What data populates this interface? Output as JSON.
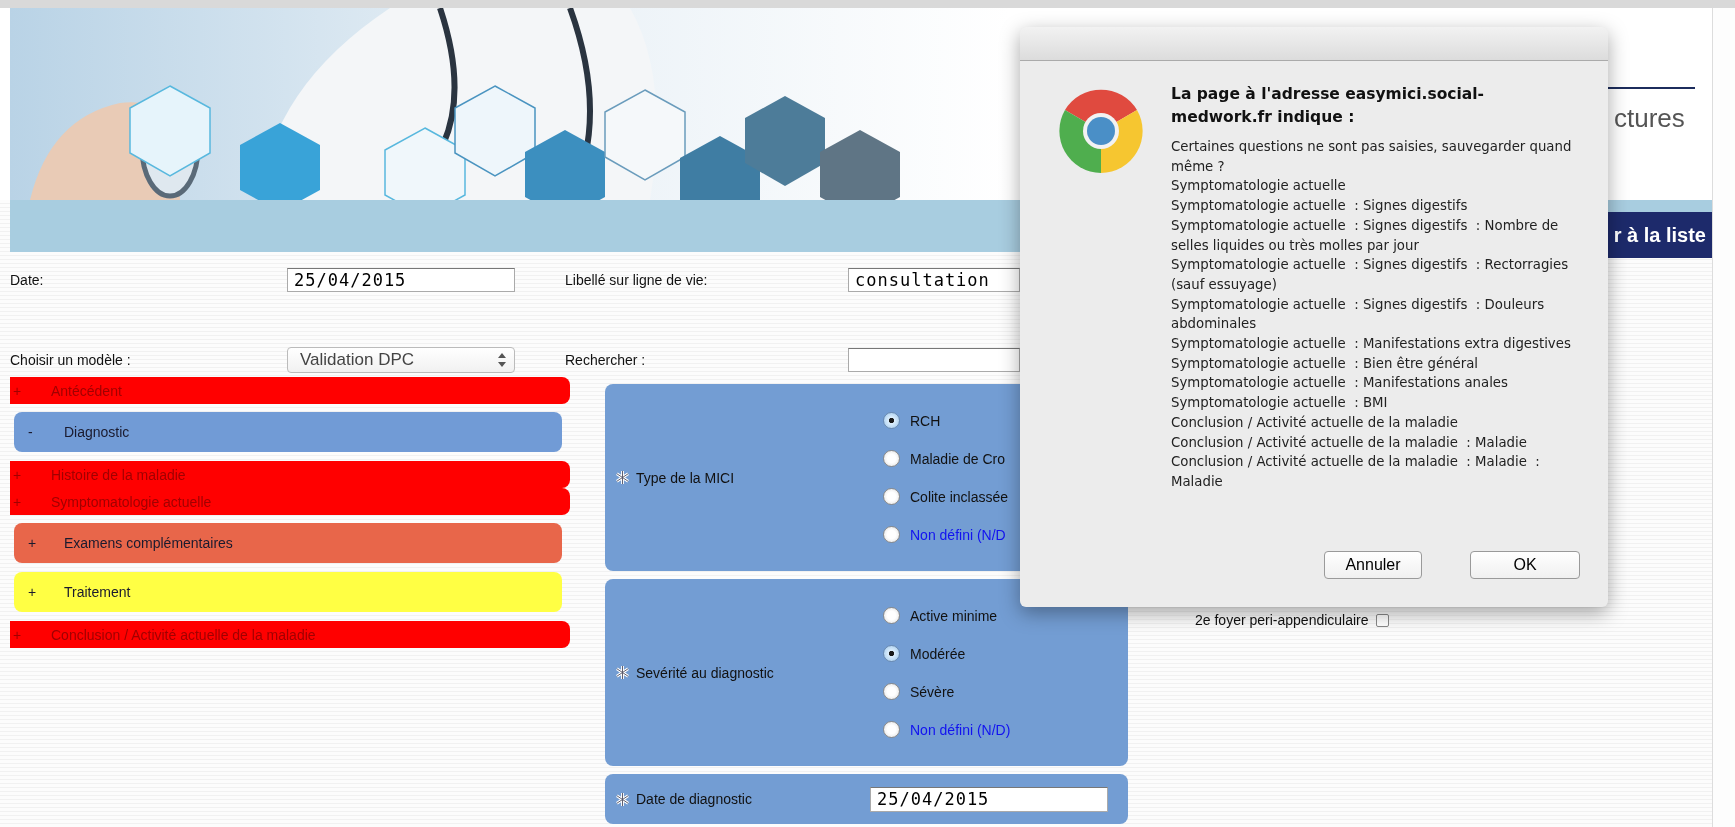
{
  "header": {
    "subtitle": "ctures",
    "back_button": "r à la liste"
  },
  "form": {
    "date": {
      "label": "Date:",
      "value": "25/04/2015"
    },
    "timeline": {
      "label": "Libellé sur ligne de vie:",
      "value": "consultation"
    },
    "model": {
      "label": "Choisir un modèle :",
      "value": "Validation DPC"
    },
    "search": {
      "label": "Rechercher :"
    }
  },
  "sections": [
    {
      "sign": "+",
      "label": "Antécédent",
      "kind": "flat",
      "color": "#ff0000"
    },
    {
      "sign": "-",
      "label": "Diagnostic",
      "kind": "block",
      "color": "#719bd6"
    },
    {
      "sign": "+",
      "label": "Histoire de la maladie",
      "kind": "flat",
      "color": "#ff0000"
    },
    {
      "sign": "+",
      "label": "Symptomatologie actuelle",
      "kind": "flat",
      "color": "#ff0000"
    },
    {
      "sign": "+",
      "label": "Examens complémentaires",
      "kind": "block",
      "color": "#e8664a"
    },
    {
      "sign": "+",
      "label": "Traitement",
      "kind": "block",
      "color": "#ffff44"
    },
    {
      "sign": "+",
      "label": "Conclusion / Activité actuelle de la maladie",
      "kind": "flat",
      "color": "#ff0000"
    }
  ],
  "questions": [
    {
      "kind": "radio",
      "label": "Type de la MICI",
      "options": [
        {
          "label": "RCH",
          "kind": "value",
          "selected": true
        },
        {
          "label": "Maladie de Cro",
          "kind": "value",
          "selected": false
        },
        {
          "label": "Colite inclassée",
          "kind": "value",
          "selected": false
        },
        {
          "label": "Non défini (N/D",
          "kind": "undefined",
          "selected": false
        }
      ]
    },
    {
      "kind": "radio",
      "label": "Sevérité au diagnostic",
      "options": [
        {
          "label": "Active minime",
          "kind": "value",
          "selected": false
        },
        {
          "label": "Modérée",
          "kind": "value",
          "selected": true
        },
        {
          "label": "Sévère",
          "kind": "value",
          "selected": false
        },
        {
          "label": "Non défini (N/D)",
          "kind": "undefined",
          "selected": false
        }
      ]
    },
    {
      "kind": "date",
      "label": "Date de diagnostic",
      "value": "25/04/2015"
    }
  ],
  "side_option": {
    "label": "2e foyer peri-appendiculaire",
    "checked": false
  },
  "dialog": {
    "title": "La page à l'adresse easymici.social-medwork.fr indique :",
    "lines": [
      "Certaines questions ne sont pas saisies, sauvegarder quand même ?",
      "Symptomatologie actuelle",
      "Symptomatologie actuelle  : Signes digestifs",
      "Symptomatologie actuelle  : Signes digestifs  : Nombre de selles liquides ou très molles par jour",
      "Symptomatologie actuelle  : Signes digestifs  : Rectorragies (sauf essuyage)",
      "Symptomatologie actuelle  : Signes digestifs  : Douleurs abdominales",
      "Symptomatologie actuelle  : Manifestations extra digestives",
      "Symptomatologie actuelle  : Bien être général",
      "Symptomatologie actuelle  : Manifestations anales",
      "Symptomatologie actuelle  : BMI",
      "Conclusion / Activité actuelle de la maladie",
      "Conclusion / Activité actuelle de la maladie  : Maladie",
      "Conclusion / Activité actuelle de la maladie  : Maladie  : Maladie"
    ],
    "buttons": [
      {
        "label": "Annuler",
        "kind": "cancel"
      },
      {
        "label": "OK",
        "kind": "default"
      }
    ]
  }
}
